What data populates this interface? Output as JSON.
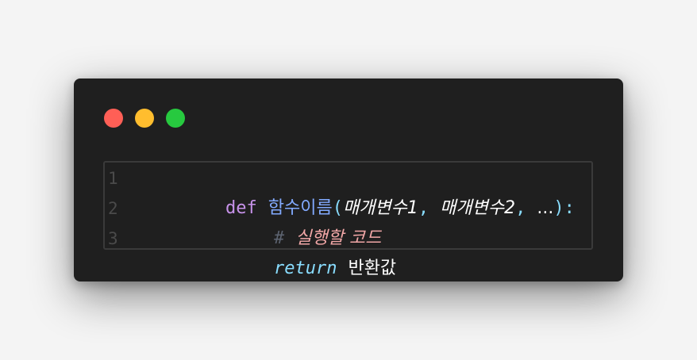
{
  "window": {
    "traffic_lights": [
      {
        "name": "close",
        "color": "#ff5f56"
      },
      {
        "name": "minimize",
        "color": "#ffbd2e"
      },
      {
        "name": "maximize",
        "color": "#27c93f"
      }
    ]
  },
  "code": {
    "lines": [
      {
        "number": "1",
        "keyword": "def",
        "function_name": "함수이름",
        "open_paren": "(",
        "param1": "매개변수1",
        "comma1": ",",
        "param2": "매개변수2",
        "comma2": ",",
        "ellipsis": "...",
        "close": "):"
      },
      {
        "number": "2",
        "comment_hash": "#",
        "comment_text": "실행할 코드"
      },
      {
        "number": "3",
        "keyword": "return",
        "value": "반환값"
      }
    ]
  },
  "colors": {
    "background": "#f4f4f4",
    "window": "#1f1f1f",
    "keyword": "#c792ea",
    "function": "#82aaff",
    "punctuation": "#89ddff",
    "comment": "#f2a7a7",
    "line_number": "#4a4a4a"
  }
}
